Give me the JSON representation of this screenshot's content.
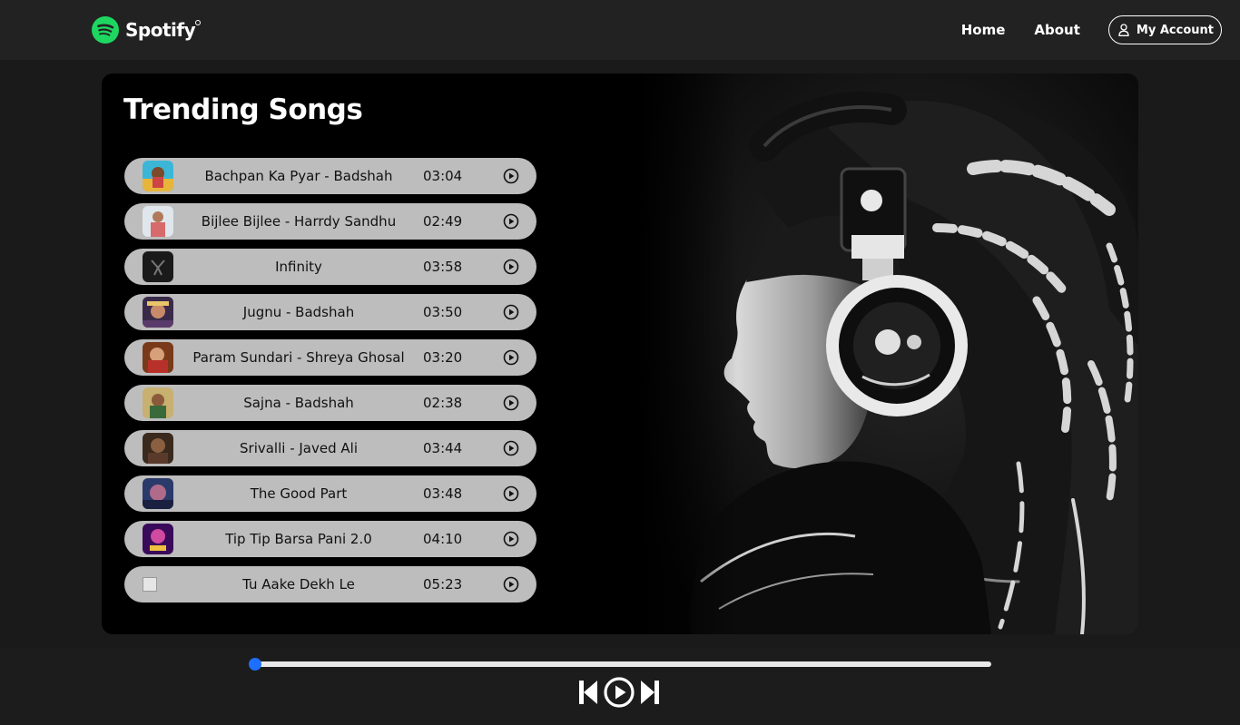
{
  "navbar": {
    "brand": "Spotify",
    "links": [
      "Home",
      "About"
    ],
    "account_label": "My Account",
    "brand_color": "#1ed760"
  },
  "main": {
    "title": "Trending Songs",
    "songs": [
      {
        "name": "Bachpan Ka Pyar - Badshah",
        "duration": "03:04",
        "thumb": "cover-colorful"
      },
      {
        "name": "Bijlee Bijlee - Harrdy Sandhu",
        "duration": "02:49",
        "thumb": "cover-portrait"
      },
      {
        "name": "Infinity",
        "duration": "03:58",
        "thumb": "cover-dark"
      },
      {
        "name": "Jugnu - Badshah",
        "duration": "03:50",
        "thumb": "cover-purple"
      },
      {
        "name": "Param Sundari - Shreya Ghosal",
        "duration": "03:20",
        "thumb": "cover-warm"
      },
      {
        "name": "Sajna - Badshah",
        "duration": "02:38",
        "thumb": "cover-green"
      },
      {
        "name": "Srivalli - Javed Ali",
        "duration": "03:44",
        "thumb": "cover-brown"
      },
      {
        "name": "The Good Part",
        "duration": "03:48",
        "thumb": "cover-night"
      },
      {
        "name": "Tip Tip Barsa Pani 2.0",
        "duration": "04:10",
        "thumb": "cover-magenta"
      },
      {
        "name": "Tu Aake Dekh Le",
        "duration": "05:23",
        "thumb": "broken-image"
      }
    ],
    "hero_image": "woman-with-headphones-bw"
  },
  "player": {
    "progress": 0,
    "accent": "#1e6fff",
    "controls": [
      "previous-icon",
      "play-icon",
      "next-icon"
    ]
  }
}
